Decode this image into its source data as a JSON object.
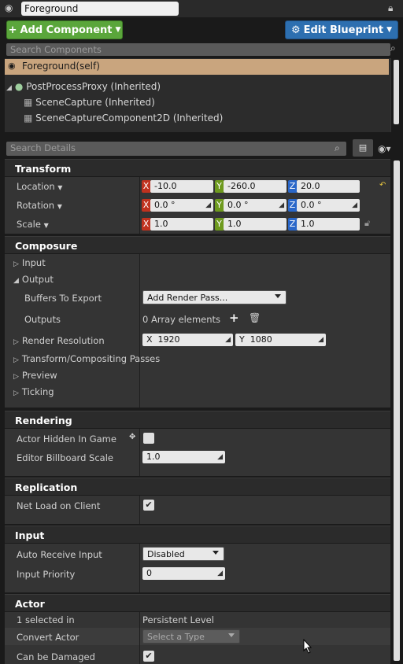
{
  "header": {
    "actor_name": "Foreground"
  },
  "buttons": {
    "add_component": "Add Component",
    "edit_blueprint": "Edit Blueprint"
  },
  "component_search": {
    "placeholder": "Search Components"
  },
  "components": [
    {
      "label": "Foreground(self)",
      "selected": true
    },
    {
      "label": "PostProcessProxy (Inherited)"
    },
    {
      "label": "SceneCapture (Inherited)"
    },
    {
      "label": "SceneCaptureComponent2D (Inherited)"
    }
  ],
  "details_search": {
    "placeholder": "Search Details"
  },
  "transform": {
    "title": "Transform",
    "location": {
      "label": "Location",
      "x": "-10.0",
      "y": "-260.0",
      "z": "20.0"
    },
    "rotation": {
      "label": "Rotation",
      "x": "0.0 °",
      "y": "0.0 °",
      "z": "0.0 °"
    },
    "scale": {
      "label": "Scale",
      "x": "1.0",
      "y": "1.0",
      "z": "1.0"
    },
    "axis": {
      "x": "X",
      "y": "Y",
      "z": "Z"
    }
  },
  "composure": {
    "title": "Composure",
    "input": "Input",
    "output": "Output",
    "buffers_label": "Buffers To Export",
    "buffers_value": "Add Render Pass...",
    "outputs_label": "Outputs",
    "outputs_value": "0 Array elements",
    "render_res_label": "Render Resolution",
    "res_x": "1920",
    "res_y": "1080",
    "transform_passes": "Transform/Compositing Passes",
    "preview": "Preview",
    "ticking": "Ticking"
  },
  "rendering": {
    "title": "Rendering",
    "hidden_label": "Actor Hidden In Game",
    "hidden_checked": false,
    "billboard_label": "Editor Billboard Scale",
    "billboard_value": "1.0"
  },
  "replication": {
    "title": "Replication",
    "net_load_label": "Net Load on Client",
    "net_load_checked": true
  },
  "input": {
    "title": "Input",
    "auto_receive_label": "Auto Receive Input",
    "auto_receive_value": "Disabled",
    "priority_label": "Input Priority",
    "priority_value": "0"
  },
  "actor": {
    "title": "Actor",
    "selected_label": "1 selected in",
    "selected_value": "Persistent Level",
    "convert_label": "Convert Actor",
    "convert_value": "Select a Type",
    "damaged_label": "Can be Damaged",
    "damaged_checked": true
  },
  "colors": {
    "add_green": "#5aa63b",
    "blueprint_blue": "#2d6fb0",
    "selected_row": "#c9a57e"
  }
}
